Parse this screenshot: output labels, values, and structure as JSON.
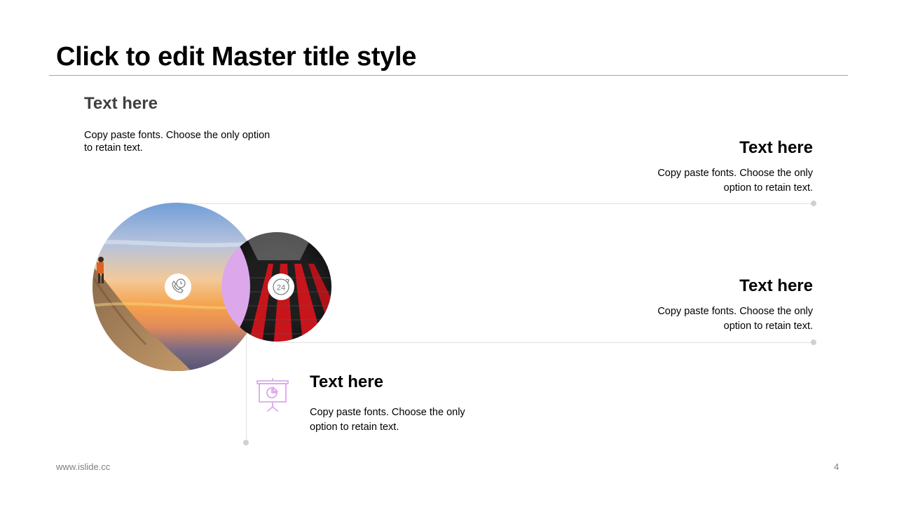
{
  "slide": {
    "title": "Click to edit Master title style",
    "footer_url": "www.islide.cc",
    "page_number": "4"
  },
  "blocks": [
    {
      "heading": "Text here",
      "line1": "Copy paste fonts. Choose the only option",
      "line2": "to retain text."
    },
    {
      "heading": "Text here",
      "line1": "Copy paste fonts. Choose the only",
      "line2": "option to retain text."
    },
    {
      "heading": "Text here",
      "line1": "Copy paste fonts. Choose the only",
      "line2": "option to retain text."
    },
    {
      "heading": "Text here",
      "line1": "Copy paste fonts. Choose the only",
      "line2": "option to retain text."
    }
  ],
  "icons": {
    "left_circle": "phone-clock-icon",
    "right_circle": "24-hour-icon",
    "bottom": "presentation-board-icon"
  },
  "colors": {
    "accent": "#dca7eb",
    "heading_top_left": "#404040",
    "rule": "#a6a6a6",
    "connector": "#e0e0e0"
  }
}
